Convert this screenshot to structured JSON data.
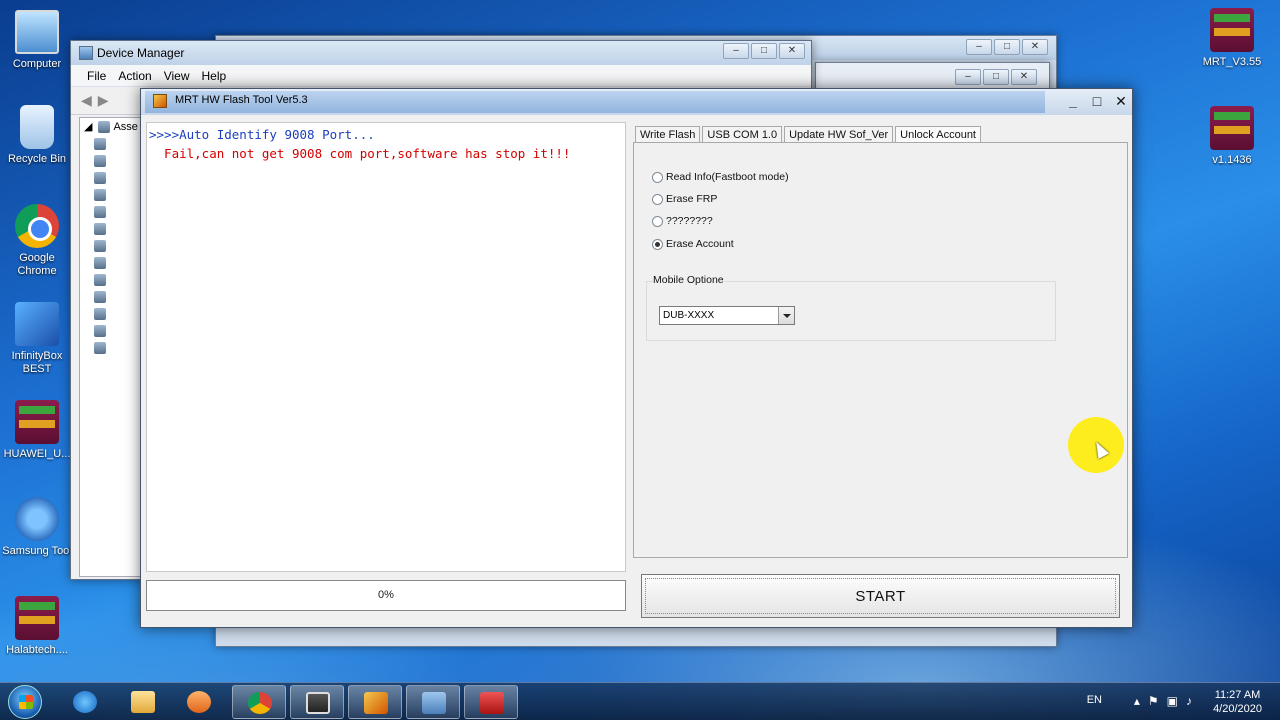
{
  "desktop": {
    "left_icons": [
      {
        "label": "Computer",
        "icon": "computer-icon"
      },
      {
        "label": "Recycle Bin",
        "icon": "recycle-bin-icon"
      },
      {
        "label": "Google Chrome",
        "icon": "chrome-icon"
      },
      {
        "label": "InfinityBox BEST",
        "icon": "infinitybox-icon"
      },
      {
        "label": "HUAWEI_U...",
        "icon": "winrar-icon"
      },
      {
        "label": "Samsung Tool",
        "icon": "samsung-tool-icon"
      },
      {
        "label": "Halabtech....",
        "icon": "winrar-icon"
      }
    ],
    "right_icons": [
      {
        "label": "MRT_V3.55",
        "icon": "winrar-icon"
      },
      {
        "label": "v1.1436",
        "icon": "winrar-icon"
      }
    ]
  },
  "device_manager": {
    "title": "Device Manager",
    "menu": [
      "File",
      "Action",
      "View",
      "Help"
    ],
    "tree_root": "Asse"
  },
  "mrt": {
    "title": "MRT HW Flash Tool Ver5.3",
    "log": {
      "line1": ">>>>Auto Identify 9008 Port...",
      "line2": "  Fail,can not get 9008 com port,software has stop it!!!"
    },
    "progress": {
      "text": "0%",
      "value": 0
    },
    "tabs": [
      "Write Flash",
      "USB COM 1.0",
      "Update HW Sof_Ver",
      "Unlock Account"
    ],
    "active_tab": "Unlock Account",
    "options": [
      {
        "label": "Read Info(Fastboot mode)",
        "checked": false
      },
      {
        "label": "Erase FRP",
        "checked": false
      },
      {
        "label": "????????",
        "checked": false
      },
      {
        "label": "Erase Account",
        "checked": true
      }
    ],
    "mobile_group_label": "Mobile Optione",
    "mobile_selected": "DUB-XXXX",
    "start_label": "START"
  },
  "taskbar": {
    "language": "EN",
    "time": "11:27 AM",
    "date": "4/20/2020"
  }
}
